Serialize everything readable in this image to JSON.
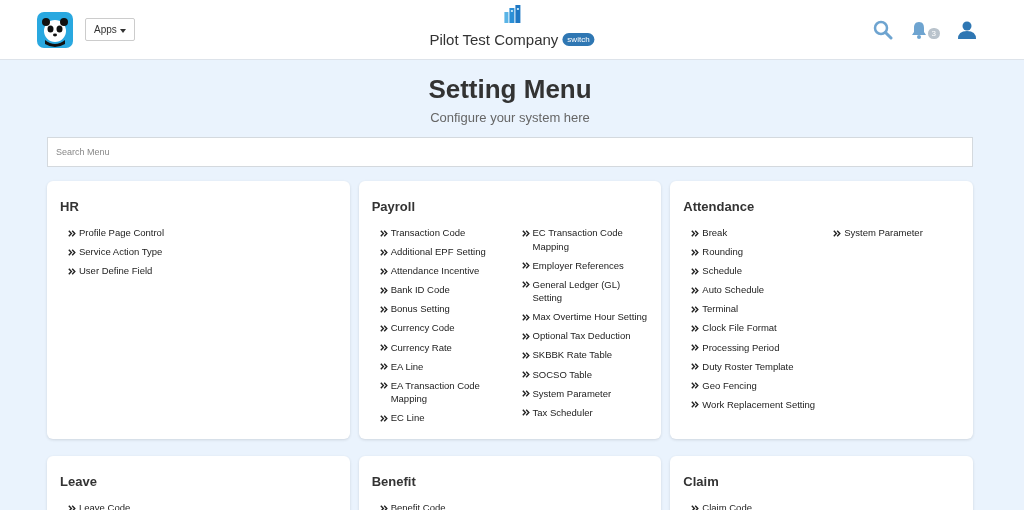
{
  "header": {
    "apps_button": "Apps",
    "company": "Pilot Test Company",
    "switch_badge": "switch",
    "notification_count": "3"
  },
  "page": {
    "title": "Setting Menu",
    "subtitle": "Configure your system here"
  },
  "search": {
    "placeholder": "Search Menu"
  },
  "cards": [
    {
      "title": "HR",
      "columns": [
        [
          "Profile Page Control",
          "Service Action Type",
          "User Define Field"
        ]
      ]
    },
    {
      "title": "Payroll",
      "columns": [
        [
          "Transaction Code",
          "Additional EPF Setting",
          "Attendance Incentive",
          "Bank ID Code",
          "Bonus Setting",
          "Currency Code",
          "Currency Rate",
          "EA Line",
          "EA Transaction Code Mapping",
          "EC Line"
        ],
        [
          "EC Transaction Code Mapping",
          "Employer References",
          "General Ledger (GL) Setting",
          "Max Overtime Hour Setting",
          "Optional Tax Deduction",
          "SKBBK Rate Table",
          "SOCSO Table",
          "System Parameter",
          "Tax Scheduler"
        ]
      ]
    },
    {
      "title": "Attendance",
      "columns": [
        [
          "Break",
          "Rounding",
          "Schedule",
          "Auto Schedule",
          "Terminal",
          "Clock File Format",
          "Processing Period",
          "Duty Roster Template",
          "Geo Fencing",
          "Work Replacement Setting"
        ],
        [
          "System Parameter"
        ]
      ]
    },
    {
      "title": "Leave",
      "columns": [
        [
          "Leave Code"
        ]
      ]
    },
    {
      "title": "Benefit",
      "columns": [
        [
          "Benefit Code"
        ]
      ]
    },
    {
      "title": "Claim",
      "columns": [
        [
          "Claim Code"
        ]
      ]
    }
  ]
}
